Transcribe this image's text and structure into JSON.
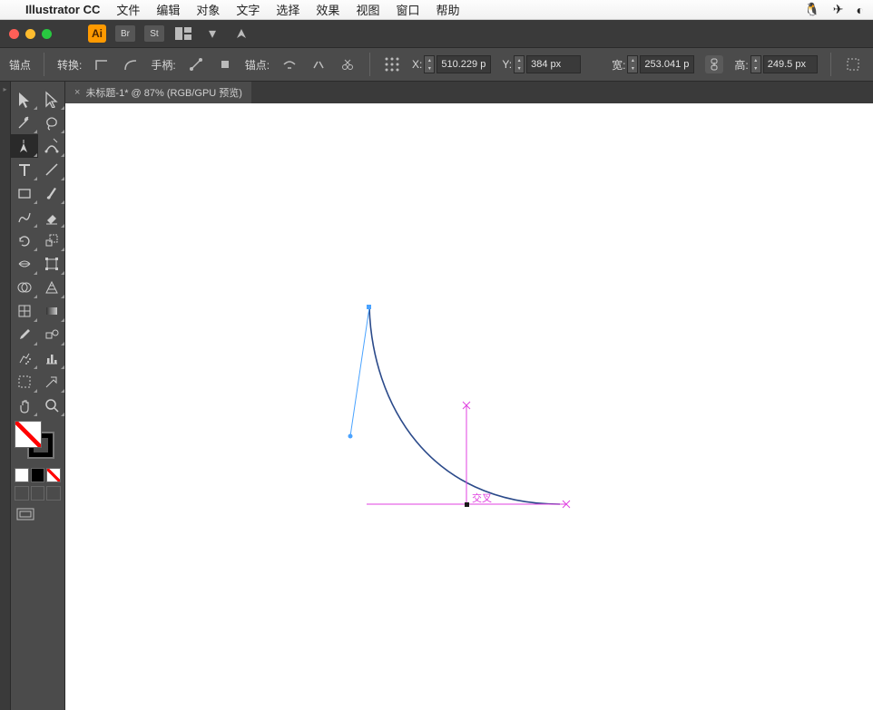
{
  "mac_menu": {
    "apple": "",
    "app": "Illustrator CC",
    "items": [
      "文件",
      "编辑",
      "对象",
      "文字",
      "选择",
      "效果",
      "视图",
      "窗口",
      "帮助"
    ],
    "right_icons": [
      "penguin-icon",
      "telegram-icon",
      "circle-icon"
    ]
  },
  "app_top": {
    "ai": "Ai",
    "badge_br": "Br",
    "badge_st": "St"
  },
  "control_bar": {
    "anchor_label": "锚点",
    "convert_label": "转换:",
    "handles_label": "手柄:",
    "anchor2_label": "锚点:",
    "x_label": "X:",
    "x_value": "510.229 p",
    "y_label": "Y:",
    "y_value": "384 px",
    "w_label": "宽:",
    "w_value": "253.041 p",
    "h_label": "高:",
    "h_value": "249.5 px"
  },
  "tab": {
    "title": "未标题-1* @ 87% (RGB/GPU 预览)"
  },
  "canvas": {
    "intersect_label": "交叉"
  },
  "tools": [
    [
      "selection-tool",
      "direct-selection-tool"
    ],
    [
      "magic-wand-tool",
      "lasso-tool"
    ],
    [
      "pen-tool",
      "curvature-tool"
    ],
    [
      "type-tool",
      "line-tool"
    ],
    [
      "rectangle-tool",
      "paintbrush-tool"
    ],
    [
      "shaper-tool",
      "eraser-tool"
    ],
    [
      "rotate-tool",
      "scale-tool"
    ],
    [
      "width-tool",
      "free-transform-tool"
    ],
    [
      "shape-builder-tool",
      "perspective-tool"
    ],
    [
      "mesh-tool",
      "gradient-tool"
    ],
    [
      "eyedropper-tool",
      "blend-tool"
    ],
    [
      "symbol-sprayer-tool",
      "graph-tool"
    ],
    [
      "artboard-tool",
      "slice-tool"
    ],
    [
      "hand-tool",
      "zoom-tool"
    ]
  ],
  "selected_tool": "pen-tool"
}
